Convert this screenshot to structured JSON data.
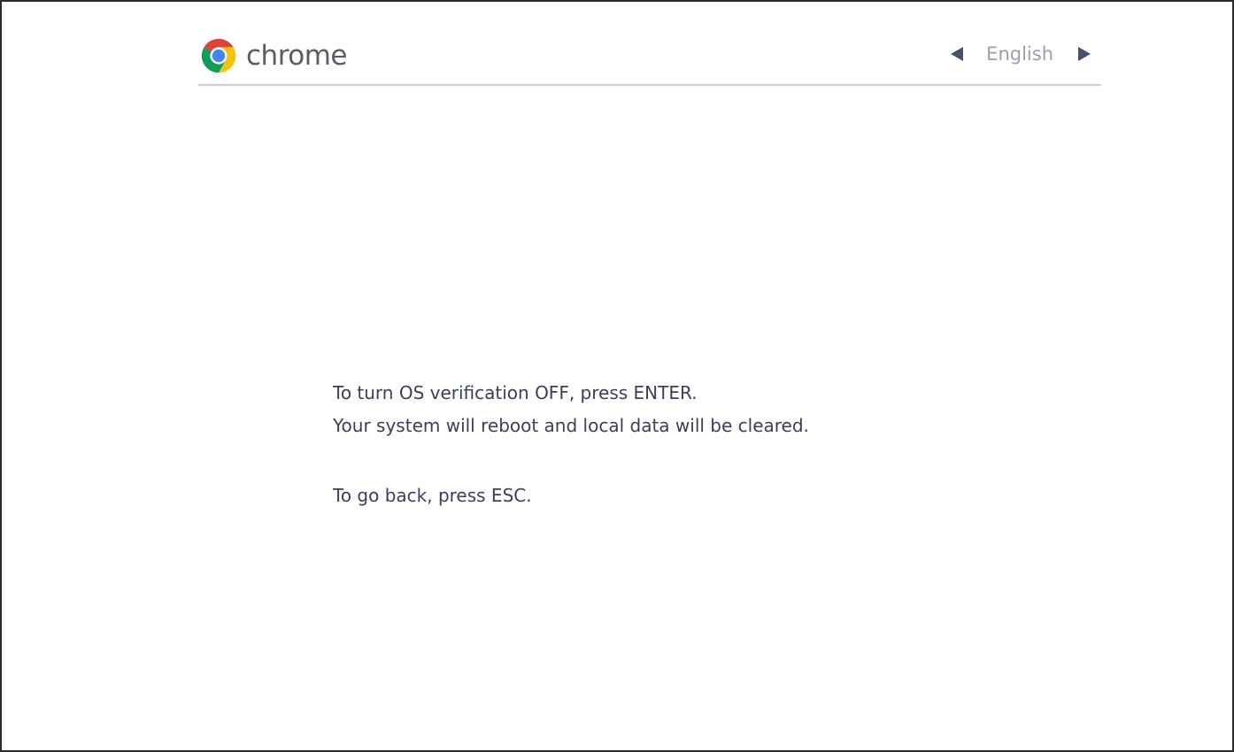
{
  "header": {
    "logo_text": "chrome",
    "language": "English",
    "prev_language_icon": "triangle-left-icon",
    "next_language_icon": "triangle-right-icon"
  },
  "message": {
    "line1": "To turn OS verification OFF, press ENTER.",
    "line2": "Your system will reboot and local data will be cleared.",
    "line3": "To go back, press ESC."
  },
  "colors": {
    "text": "#3a3f5a",
    "logo_text": "#5a5d66",
    "language_text": "#9aa0ac",
    "arrow": "#4a4f6a",
    "divider": "#c7cad3",
    "chrome_red": "#db4437",
    "chrome_yellow": "#f4c20d",
    "chrome_green": "#0f9d58",
    "chrome_blue": "#4285f4"
  }
}
